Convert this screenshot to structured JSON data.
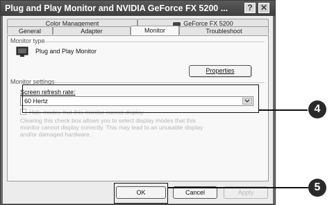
{
  "window": {
    "title": "Plug and Play Monitor and NVIDIA GeForce FX 5200 ...",
    "help_glyph": "?",
    "close_glyph": "✕"
  },
  "tabs": {
    "row1": [
      "Color Management",
      "GeForce FX 5200"
    ],
    "row2": [
      "General",
      "Adapter",
      "Monitor",
      "Troubleshoot"
    ],
    "active": "Monitor"
  },
  "monitor_type": {
    "group_label": "Monitor type",
    "monitor_name": "Plug and Play Monitor",
    "properties_button": "Properties"
  },
  "monitor_settings": {
    "group_label": "Monitor settings",
    "refresh_label": "Screen refresh rate:",
    "refresh_value": "60 Hertz",
    "hide_modes_label": "Hide modes that this monitor cannot display",
    "hide_modes_checked": false,
    "hint_lines": [
      "Clearing this check box allows you to select display modes that this",
      "monitor cannot display correctly. This may lead to an unusable display",
      "and/or damaged hardware."
    ]
  },
  "buttons": {
    "ok": "OK",
    "cancel": "Cancel",
    "apply": "Apply"
  },
  "callouts": {
    "settings_step": "4",
    "ok_step": "5"
  }
}
